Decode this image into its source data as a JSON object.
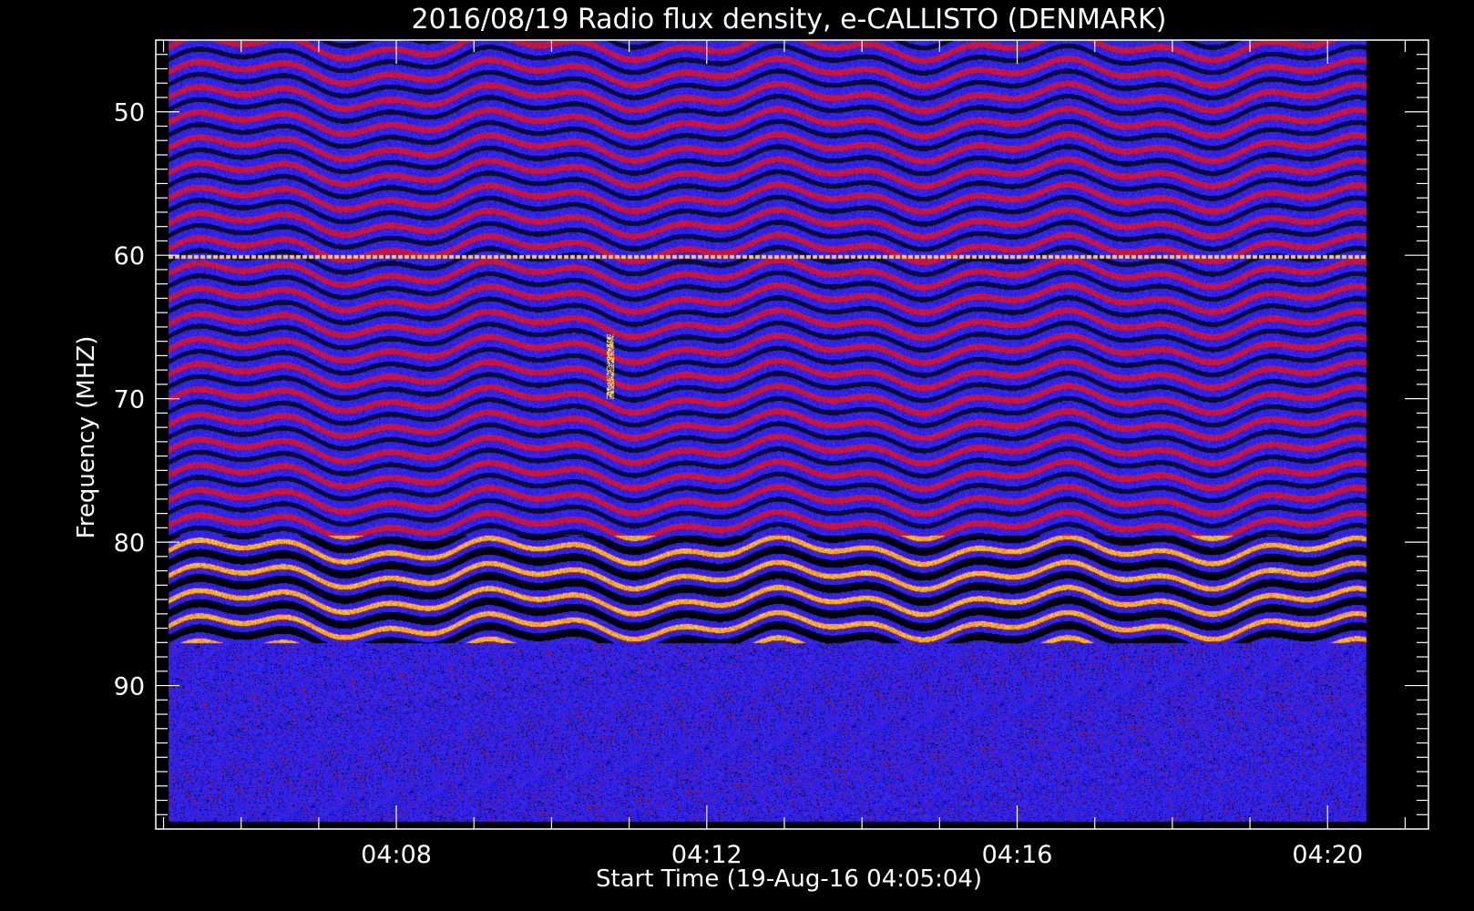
{
  "chart_data": {
    "type": "heatmap",
    "title": "2016/08/19  Radio flux density, e-CALLISTO (DENMARK)",
    "xlabel": "Start Time (19-Aug-16 04:05:04)",
    "ylabel": "Frequency (MHZ)",
    "x_ticks": [
      "04:08",
      "04:12",
      "04:16",
      "04:20"
    ],
    "x_tick_minutes": [
      8,
      12,
      16,
      20
    ],
    "y_ticks": [
      "50",
      "60",
      "70",
      "80",
      "90"
    ],
    "y_tick_values": [
      50,
      60,
      70,
      80,
      90
    ],
    "xlim_minutes": [
      4.9,
      21.3
    ],
    "xlim_data_minutes": [
      5.07,
      20.5
    ],
    "ylim_mhz": [
      45,
      100
    ],
    "ylim_data_mhz": [
      45,
      99.5
    ],
    "colors": {
      "background": "#000000",
      "axis": "#ffffff",
      "noise_blue": "#2020ff",
      "band_red": "#c01818",
      "band_dark": "#000020",
      "hot_yellow": "#ffd040"
    },
    "features": {
      "interference_line_mhz": 60.1,
      "strong_band_mhz": [
        79.5,
        87
      ],
      "lower_noise_band_mhz": [
        87,
        99.5
      ],
      "burst_time_minutes": 10.75,
      "burst_freq_mhz": [
        65.5,
        70
      ]
    }
  }
}
